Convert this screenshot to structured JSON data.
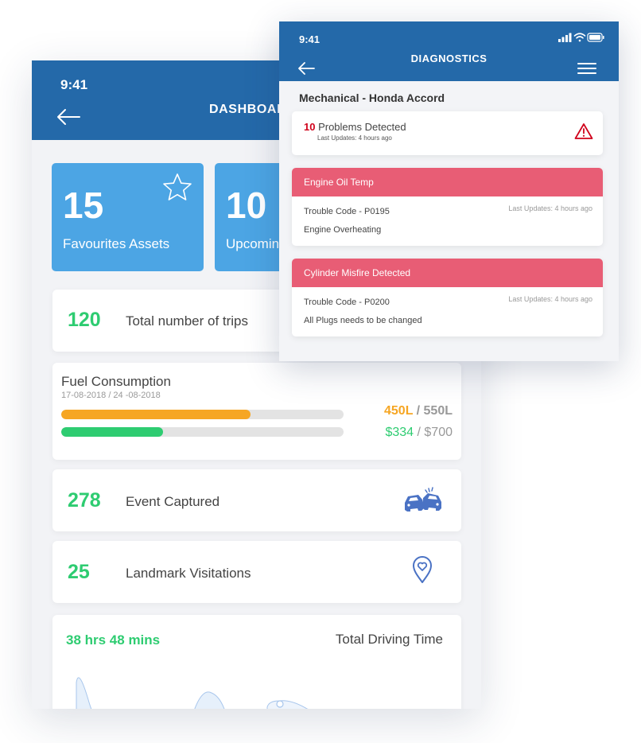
{
  "dashboard": {
    "status_time": "9:41",
    "title": "DASHBOARD",
    "tiles": [
      {
        "value": "15",
        "label": "Favourites Assets"
      },
      {
        "value": "10",
        "label": "Upcoming Services"
      }
    ],
    "trips": {
      "value": "120",
      "label": "Total number of trips"
    },
    "fuel": {
      "title": "Fuel Consumption",
      "date_range": "17-08-2018 / 24 -08-2018",
      "litres_used": "450L",
      "litres_total": " / 550L",
      "cost_used": "$334",
      "cost_total": " / $700",
      "litres_fraction": 0.67,
      "cost_fraction": 0.36
    },
    "events": {
      "value": "278",
      "label": "Event Captured"
    },
    "landmarks": {
      "value": "25",
      "label": "Landmark Visitations"
    },
    "driving": {
      "value": "38 hrs 48 mins",
      "label": "Total Driving Time"
    }
  },
  "diagnostics": {
    "status_time": "9:41",
    "title": "DIAGNOSTICS",
    "vehicle": "Mechanical - Honda Accord",
    "problems": {
      "count": "10",
      "label": " Problems Detected",
      "updated": "Last Updates: 4 hours ago"
    },
    "issues": [
      {
        "title": "Engine Oil Temp",
        "code": "Trouble Code - P0195",
        "updated": "Last Updates: 4 hours ago",
        "description": "Engine Overheating"
      },
      {
        "title": "Cylinder Misfire Detected",
        "code": "Trouble Code - P0200",
        "updated": "Last Updates: 4 hours ago",
        "description": "All Plugs needs to be changed"
      }
    ]
  },
  "colors": {
    "header_blue": "#2469a9",
    "tile_blue": "#4ca5e4",
    "accent_green": "#2ecc71",
    "accent_orange": "#f6a623",
    "alert_red": "#e85d75",
    "warning_red": "#d0021b"
  },
  "icons": [
    "back-arrow-icon",
    "star-icon",
    "car-collision-icon",
    "location-pin-icon",
    "signal-icon",
    "wifi-icon",
    "battery-icon",
    "hamburger-menu-icon",
    "warning-triangle-icon"
  ]
}
